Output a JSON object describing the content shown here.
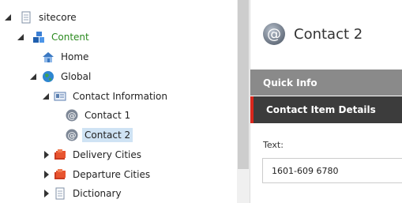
{
  "tree": {
    "items": [
      {
        "label": "sitecore",
        "toggle": "expanded",
        "icon": "page-icon"
      },
      {
        "label": "Content",
        "toggle": "expanded",
        "icon": "content-cubes-icon"
      },
      {
        "label": "Home",
        "toggle": "none",
        "icon": "home-icon"
      },
      {
        "label": "Global",
        "toggle": "expanded",
        "icon": "globe-icon"
      },
      {
        "label": "Contact Information",
        "toggle": "expanded",
        "icon": "contact-card-icon"
      },
      {
        "label": "Contact 1",
        "toggle": "none",
        "icon": "at-sign-icon"
      },
      {
        "label": "Contact 2",
        "toggle": "none",
        "icon": "at-sign-icon",
        "selected": true
      },
      {
        "label": "Delivery Cities",
        "toggle": "collapsed",
        "icon": "folder-red-icon"
      },
      {
        "label": "Departure Cities",
        "toggle": "collapsed",
        "icon": "folder-red-icon"
      },
      {
        "label": "Dictionary",
        "toggle": "collapsed",
        "icon": "document-icon"
      }
    ]
  },
  "editor": {
    "title": "Contact 2",
    "title_icon": "at-sign-icon",
    "sections": {
      "quick_info": "Quick Info",
      "item_details": "Contact Item Details"
    },
    "field": {
      "label": "Text:",
      "value": "1601-609 6780"
    }
  },
  "colors": {
    "selected_bg": "#cfe3f4",
    "content_label": "#2b8a1f",
    "section_bar_light": "#8a8a8a",
    "section_bar_dark": "#3c3c3c",
    "accent_red": "#d9261c"
  }
}
